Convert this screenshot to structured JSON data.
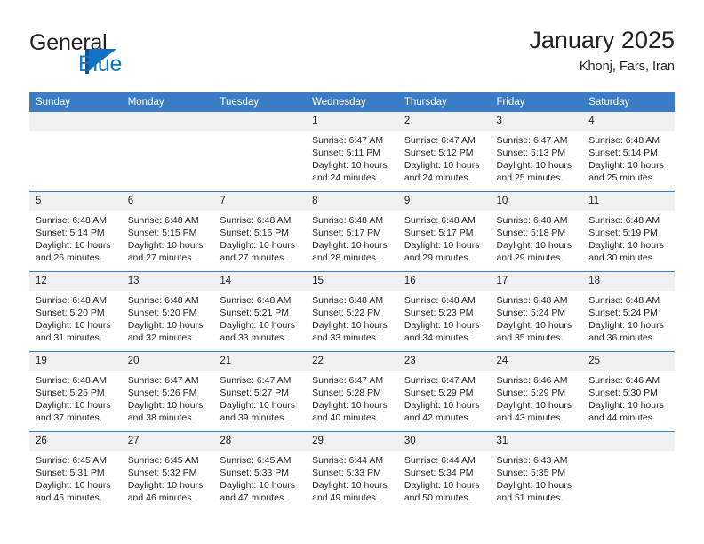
{
  "brand": {
    "name_part1": "General",
    "name_part2": "Blue",
    "accent_color": "#1273c4",
    "dark_accent_color": "#18508f"
  },
  "header": {
    "title": "January 2025",
    "location": "Khonj, Fars, Iran"
  },
  "theme": {
    "header_blue": "#3b7dc4",
    "daynum_strip": "#f0f0f0",
    "text": "#231f20"
  },
  "weekday_headers": [
    "Sunday",
    "Monday",
    "Tuesday",
    "Wednesday",
    "Thursday",
    "Friday",
    "Saturday"
  ],
  "weeks": [
    [
      {
        "day": "",
        "lines": []
      },
      {
        "day": "",
        "lines": []
      },
      {
        "day": "",
        "lines": []
      },
      {
        "day": "1",
        "lines": [
          "Sunrise: 6:47 AM",
          "Sunset: 5:11 PM",
          "Daylight: 10 hours",
          "and 24 minutes."
        ]
      },
      {
        "day": "2",
        "lines": [
          "Sunrise: 6:47 AM",
          "Sunset: 5:12 PM",
          "Daylight: 10 hours",
          "and 24 minutes."
        ]
      },
      {
        "day": "3",
        "lines": [
          "Sunrise: 6:47 AM",
          "Sunset: 5:13 PM",
          "Daylight: 10 hours",
          "and 25 minutes."
        ]
      },
      {
        "day": "4",
        "lines": [
          "Sunrise: 6:48 AM",
          "Sunset: 5:14 PM",
          "Daylight: 10 hours",
          "and 25 minutes."
        ]
      }
    ],
    [
      {
        "day": "5",
        "lines": [
          "Sunrise: 6:48 AM",
          "Sunset: 5:14 PM",
          "Daylight: 10 hours",
          "and 26 minutes."
        ]
      },
      {
        "day": "6",
        "lines": [
          "Sunrise: 6:48 AM",
          "Sunset: 5:15 PM",
          "Daylight: 10 hours",
          "and 27 minutes."
        ]
      },
      {
        "day": "7",
        "lines": [
          "Sunrise: 6:48 AM",
          "Sunset: 5:16 PM",
          "Daylight: 10 hours",
          "and 27 minutes."
        ]
      },
      {
        "day": "8",
        "lines": [
          "Sunrise: 6:48 AM",
          "Sunset: 5:17 PM",
          "Daylight: 10 hours",
          "and 28 minutes."
        ]
      },
      {
        "day": "9",
        "lines": [
          "Sunrise: 6:48 AM",
          "Sunset: 5:17 PM",
          "Daylight: 10 hours",
          "and 29 minutes."
        ]
      },
      {
        "day": "10",
        "lines": [
          "Sunrise: 6:48 AM",
          "Sunset: 5:18 PM",
          "Daylight: 10 hours",
          "and 29 minutes."
        ]
      },
      {
        "day": "11",
        "lines": [
          "Sunrise: 6:48 AM",
          "Sunset: 5:19 PM",
          "Daylight: 10 hours",
          "and 30 minutes."
        ]
      }
    ],
    [
      {
        "day": "12",
        "lines": [
          "Sunrise: 6:48 AM",
          "Sunset: 5:20 PM",
          "Daylight: 10 hours",
          "and 31 minutes."
        ]
      },
      {
        "day": "13",
        "lines": [
          "Sunrise: 6:48 AM",
          "Sunset: 5:20 PM",
          "Daylight: 10 hours",
          "and 32 minutes."
        ]
      },
      {
        "day": "14",
        "lines": [
          "Sunrise: 6:48 AM",
          "Sunset: 5:21 PM",
          "Daylight: 10 hours",
          "and 33 minutes."
        ]
      },
      {
        "day": "15",
        "lines": [
          "Sunrise: 6:48 AM",
          "Sunset: 5:22 PM",
          "Daylight: 10 hours",
          "and 33 minutes."
        ]
      },
      {
        "day": "16",
        "lines": [
          "Sunrise: 6:48 AM",
          "Sunset: 5:23 PM",
          "Daylight: 10 hours",
          "and 34 minutes."
        ]
      },
      {
        "day": "17",
        "lines": [
          "Sunrise: 6:48 AM",
          "Sunset: 5:24 PM",
          "Daylight: 10 hours",
          "and 35 minutes."
        ]
      },
      {
        "day": "18",
        "lines": [
          "Sunrise: 6:48 AM",
          "Sunset: 5:24 PM",
          "Daylight: 10 hours",
          "and 36 minutes."
        ]
      }
    ],
    [
      {
        "day": "19",
        "lines": [
          "Sunrise: 6:48 AM",
          "Sunset: 5:25 PM",
          "Daylight: 10 hours",
          "and 37 minutes."
        ]
      },
      {
        "day": "20",
        "lines": [
          "Sunrise: 6:47 AM",
          "Sunset: 5:26 PM",
          "Daylight: 10 hours",
          "and 38 minutes."
        ]
      },
      {
        "day": "21",
        "lines": [
          "Sunrise: 6:47 AM",
          "Sunset: 5:27 PM",
          "Daylight: 10 hours",
          "and 39 minutes."
        ]
      },
      {
        "day": "22",
        "lines": [
          "Sunrise: 6:47 AM",
          "Sunset: 5:28 PM",
          "Daylight: 10 hours",
          "and 40 minutes."
        ]
      },
      {
        "day": "23",
        "lines": [
          "Sunrise: 6:47 AM",
          "Sunset: 5:29 PM",
          "Daylight: 10 hours",
          "and 42 minutes."
        ]
      },
      {
        "day": "24",
        "lines": [
          "Sunrise: 6:46 AM",
          "Sunset: 5:29 PM",
          "Daylight: 10 hours",
          "and 43 minutes."
        ]
      },
      {
        "day": "25",
        "lines": [
          "Sunrise: 6:46 AM",
          "Sunset: 5:30 PM",
          "Daylight: 10 hours",
          "and 44 minutes."
        ]
      }
    ],
    [
      {
        "day": "26",
        "lines": [
          "Sunrise: 6:45 AM",
          "Sunset: 5:31 PM",
          "Daylight: 10 hours",
          "and 45 minutes."
        ]
      },
      {
        "day": "27",
        "lines": [
          "Sunrise: 6:45 AM",
          "Sunset: 5:32 PM",
          "Daylight: 10 hours",
          "and 46 minutes."
        ]
      },
      {
        "day": "28",
        "lines": [
          "Sunrise: 6:45 AM",
          "Sunset: 5:33 PM",
          "Daylight: 10 hours",
          "and 47 minutes."
        ]
      },
      {
        "day": "29",
        "lines": [
          "Sunrise: 6:44 AM",
          "Sunset: 5:33 PM",
          "Daylight: 10 hours",
          "and 49 minutes."
        ]
      },
      {
        "day": "30",
        "lines": [
          "Sunrise: 6:44 AM",
          "Sunset: 5:34 PM",
          "Daylight: 10 hours",
          "and 50 minutes."
        ]
      },
      {
        "day": "31",
        "lines": [
          "Sunrise: 6:43 AM",
          "Sunset: 5:35 PM",
          "Daylight: 10 hours",
          "and 51 minutes."
        ]
      },
      {
        "day": "",
        "lines": []
      }
    ]
  ]
}
